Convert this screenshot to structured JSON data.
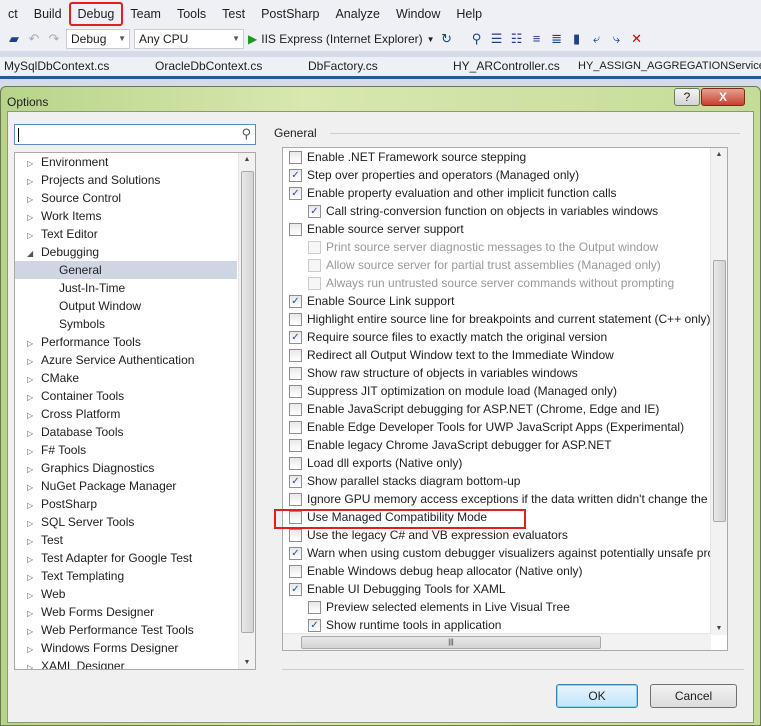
{
  "menubar": {
    "items": [
      "ct",
      "Build",
      "Debug",
      "Team",
      "Tools",
      "Test",
      "PostSharp",
      "Analyze",
      "Window",
      "Help"
    ],
    "highlighted": "Debug",
    "highlight_color": "#e02020"
  },
  "toolbar": {
    "config": "Debug",
    "platform": "Any CPU",
    "run_target": "IIS Express (Internet Explorer)"
  },
  "tabs": [
    "MySqlDbContext.cs",
    "OracleDbContext.cs",
    "DbFactory.cs",
    "HY_ARController.cs",
    "HY_ASSIGN_AGGREGATIONService"
  ],
  "dialog": {
    "title": "Options",
    "help": "?",
    "close": "X",
    "search_value": "",
    "section_title": "General",
    "ok": "OK",
    "cancel": "Cancel"
  },
  "tree": [
    {
      "label": "Environment",
      "state": "collapsed"
    },
    {
      "label": "Projects and Solutions",
      "state": "collapsed"
    },
    {
      "label": "Source Control",
      "state": "collapsed"
    },
    {
      "label": "Work Items",
      "state": "collapsed"
    },
    {
      "label": "Text Editor",
      "state": "collapsed"
    },
    {
      "label": "Debugging",
      "state": "expanded"
    },
    {
      "label": "General",
      "child": true,
      "selected": true
    },
    {
      "label": "Just-In-Time",
      "child": true
    },
    {
      "label": "Output Window",
      "child": true
    },
    {
      "label": "Symbols",
      "child": true
    },
    {
      "label": "Performance Tools",
      "state": "collapsed"
    },
    {
      "label": "Azure Service Authentication",
      "state": "collapsed"
    },
    {
      "label": "CMake",
      "state": "collapsed"
    },
    {
      "label": "Container Tools",
      "state": "collapsed"
    },
    {
      "label": "Cross Platform",
      "state": "collapsed"
    },
    {
      "label": "Database Tools",
      "state": "collapsed"
    },
    {
      "label": "F# Tools",
      "state": "collapsed"
    },
    {
      "label": "Graphics Diagnostics",
      "state": "collapsed"
    },
    {
      "label": "NuGet Package Manager",
      "state": "collapsed"
    },
    {
      "label": "PostSharp",
      "state": "collapsed"
    },
    {
      "label": "SQL Server Tools",
      "state": "collapsed"
    },
    {
      "label": "Test",
      "state": "collapsed"
    },
    {
      "label": "Test Adapter for Google Test",
      "state": "collapsed"
    },
    {
      "label": "Text Templating",
      "state": "collapsed"
    },
    {
      "label": "Web",
      "state": "collapsed"
    },
    {
      "label": "Web Forms Designer",
      "state": "collapsed"
    },
    {
      "label": "Web Performance Test Tools",
      "state": "collapsed"
    },
    {
      "label": "Windows Forms Designer",
      "state": "collapsed"
    },
    {
      "label": "XAML Designer",
      "state": "collapsed"
    }
  ],
  "options": [
    {
      "label": "Enable .NET Framework source stepping",
      "checked": false
    },
    {
      "label": "Step over properties and operators (Managed only)",
      "checked": true
    },
    {
      "label": "Enable property evaluation and other implicit function calls",
      "checked": true
    },
    {
      "label": "Call string-conversion function on objects in variables windows",
      "checked": true,
      "indent": true
    },
    {
      "label": "Enable source server support",
      "checked": false
    },
    {
      "label": "Print source server diagnostic messages to the Output window",
      "checked": false,
      "indent": true,
      "disabled": true
    },
    {
      "label": "Allow source server for partial trust assemblies (Managed only)",
      "checked": false,
      "indent": true,
      "disabled": true
    },
    {
      "label": "Always run untrusted source server commands without prompting",
      "checked": false,
      "indent": true,
      "disabled": true
    },
    {
      "label": "Enable Source Link support",
      "checked": true
    },
    {
      "label": "Highlight entire source line for breakpoints and current statement (C++ only)",
      "checked": false
    },
    {
      "label": "Require source files to exactly match the original version",
      "checked": true
    },
    {
      "label": "Redirect all Output Window text to the Immediate Window",
      "checked": false
    },
    {
      "label": "Show raw structure of objects in variables windows",
      "checked": false
    },
    {
      "label": "Suppress JIT optimization on module load (Managed only)",
      "checked": false
    },
    {
      "label": "Enable JavaScript debugging for ASP.NET (Chrome, Edge and IE)",
      "checked": false
    },
    {
      "label": "Enable Edge Developer Tools for UWP JavaScript Apps (Experimental)",
      "checked": false
    },
    {
      "label": "Enable legacy Chrome JavaScript debugger for ASP.NET",
      "checked": false
    },
    {
      "label": "Load dll exports (Native only)",
      "checked": false
    },
    {
      "label": "Show parallel stacks diagram bottom-up",
      "checked": true
    },
    {
      "label": "Ignore GPU memory access exceptions if the data written didn't change the v",
      "checked": false
    },
    {
      "label": "Use Managed Compatibility Mode",
      "checked": false,
      "highlighted": true
    },
    {
      "label": "Use the legacy C# and VB expression evaluators",
      "checked": false
    },
    {
      "label": "Warn when using custom debugger visualizers against potentially unsafe pro",
      "checked": true
    },
    {
      "label": "Enable Windows debug heap allocator (Native only)",
      "checked": false
    },
    {
      "label": "Enable UI Debugging Tools for XAML",
      "checked": true
    },
    {
      "label": "Preview selected elements in Live Visual Tree",
      "checked": false,
      "indent": true
    },
    {
      "label": "Show runtime tools in application",
      "checked": true,
      "indent": true
    }
  ]
}
